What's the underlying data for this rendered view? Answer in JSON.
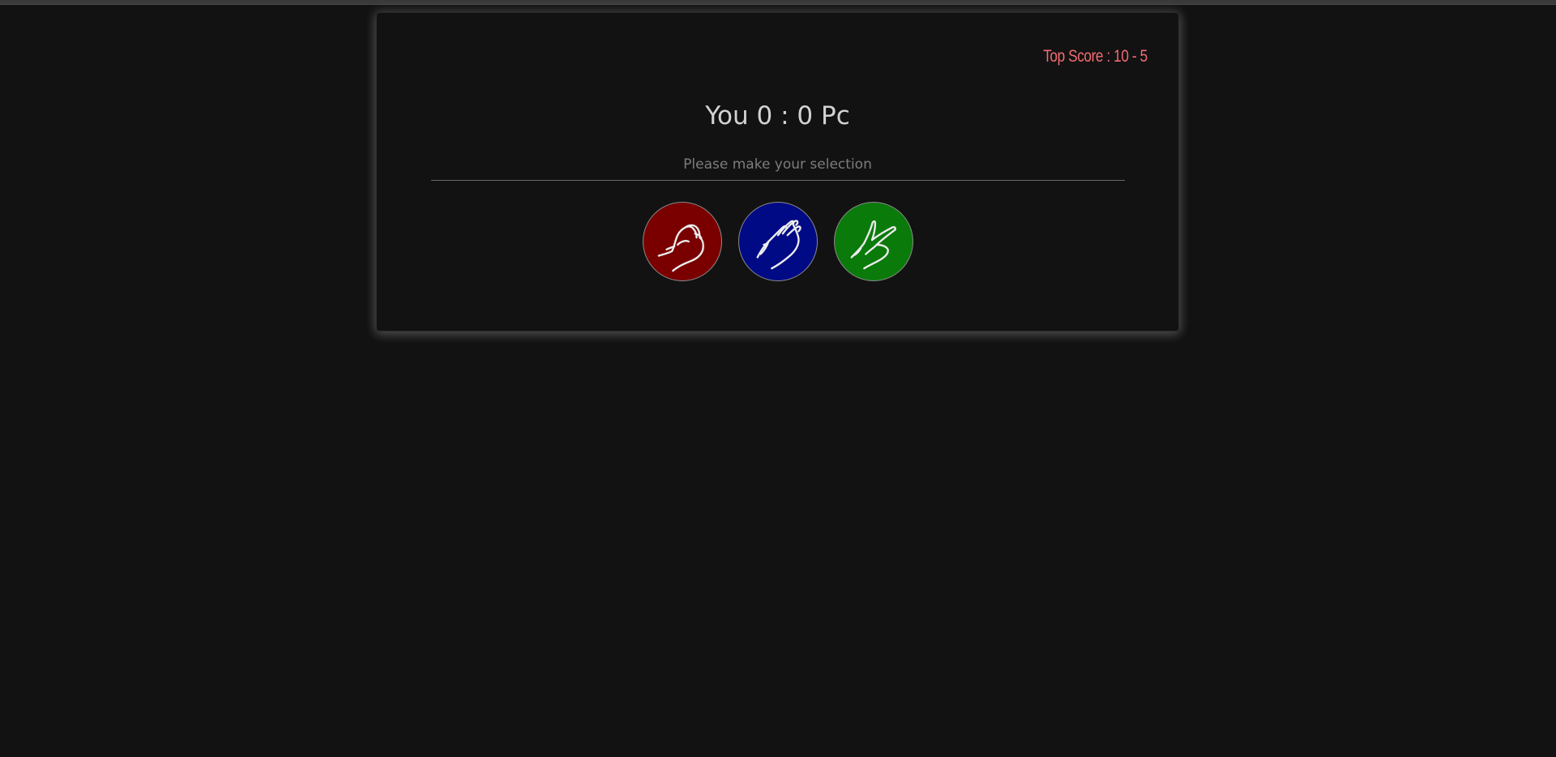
{
  "game": {
    "top_score": "Top Score : 10 - 5",
    "player_label": "You",
    "player_score": "0",
    "separator": ":",
    "pc_score": "0",
    "pc_label": "Pc",
    "message": "Please make your selection"
  },
  "choices": [
    {
      "name": "rock",
      "icon": "rock-hand-icon",
      "color": "#7a0000"
    },
    {
      "name": "paper",
      "icon": "paper-hand-icon",
      "color": "#000a85"
    },
    {
      "name": "scissors",
      "icon": "scissors-hand-icon",
      "color": "#0a7a0a"
    }
  ],
  "colors": {
    "background": "#121212",
    "top_score": "#f26b73",
    "score_text": "#d2d2d2",
    "message_text": "#7c7c7c"
  }
}
